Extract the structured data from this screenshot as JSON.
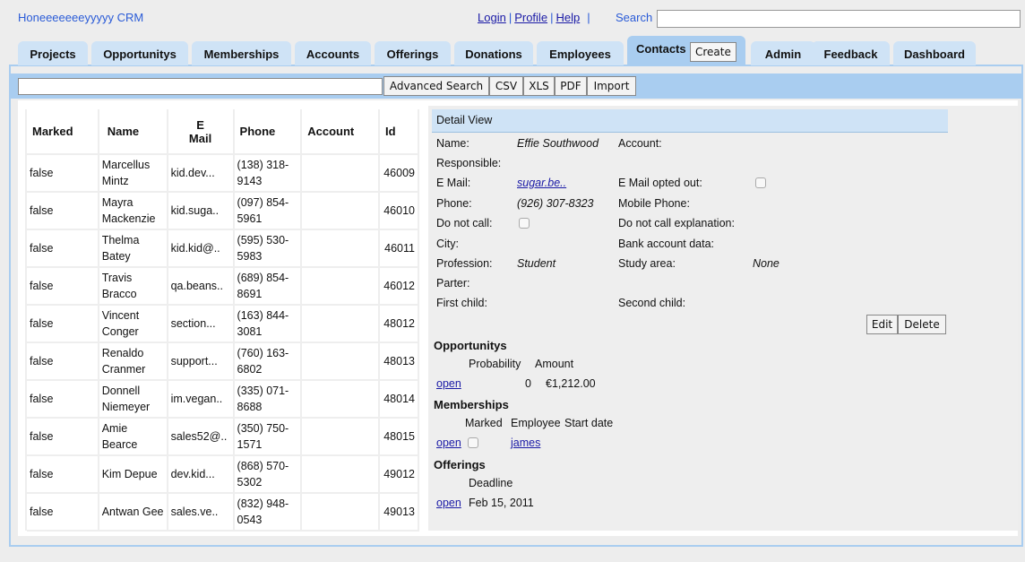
{
  "header": {
    "brand": "Honeeeeeeeyyyyy CRM",
    "links": [
      "Login",
      "Profile",
      "Help"
    ],
    "search_label": "Search",
    "search_value": ""
  },
  "tabs": [
    {
      "label": "Projects"
    },
    {
      "label": "Opportunitys"
    },
    {
      "label": "Memberships"
    },
    {
      "label": "Accounts"
    },
    {
      "label": "Offerings"
    },
    {
      "label": "Donations"
    },
    {
      "label": "Employees"
    },
    {
      "label": "Contacts",
      "active": true
    },
    {
      "label": "Admin"
    },
    {
      "label": "Feedback"
    },
    {
      "label": "Dashboard"
    }
  ],
  "create_label": "Create",
  "toolbar": {
    "search_value": "",
    "buttons": [
      "Advanced Search",
      "CSV",
      "XLS",
      "PDF",
      "Import"
    ]
  },
  "table": {
    "columns": [
      "Marked",
      "Name",
      "E Mail",
      "Phone",
      "Account",
      "Id"
    ],
    "rows": [
      [
        "false",
        "Marcellus Mintz",
        "kid.dev...",
        "(138) 318-9143",
        "",
        "46009"
      ],
      [
        "false",
        "Mayra Mackenzie",
        "kid.suga..",
        "(097) 854-5961",
        "",
        "46010"
      ],
      [
        "false",
        "Thelma Batey",
        "kid.kid@..",
        "(595) 530-5983",
        "",
        "46011"
      ],
      [
        "false",
        "Travis Bracco",
        "qa.beans..",
        "(689) 854-8691",
        "",
        "46012"
      ],
      [
        "false",
        "Vincent Conger",
        "section...",
        "(163) 844-3081",
        "",
        "48012"
      ],
      [
        "false",
        "Renaldo Cranmer",
        "support...",
        "(760) 163-6802",
        "",
        "48013"
      ],
      [
        "false",
        "Donnell Niemeyer",
        "im.vegan..",
        "(335) 071-8688",
        "",
        "48014"
      ],
      [
        "false",
        "Amie Bearce",
        "sales52@..",
        "(350) 750-1571",
        "",
        "48015"
      ],
      [
        "false",
        "Kim Depue",
        "dev.kid...",
        "(868) 570-5302",
        "",
        "49012"
      ],
      [
        "false",
        "Antwan Gee",
        "sales.ve..",
        "(832) 948-0543",
        "",
        "49013"
      ]
    ]
  },
  "detail": {
    "title": "Detail View",
    "name_label": "Name:",
    "name": "Effie Southwood",
    "account_label": "Account:",
    "responsible_label": "Responsible:",
    "email_label": "E Mail:",
    "email": "sugar.be..",
    "optout_label": "E Mail opted out:",
    "optout": false,
    "phone_label": "Phone:",
    "phone": "(926) 307-8323",
    "mobile_label": "Mobile Phone:",
    "dnc_label": "Do not call:",
    "dnc": false,
    "dnc_expl_label": "Do not call explanation:",
    "city_label": "City:",
    "bank_label": "Bank account data:",
    "profession_label": "Profession:",
    "profession": "Student",
    "study_label": "Study area:",
    "study": "None",
    "parter_label": "Parter:",
    "first_child_label": "First child:",
    "second_child_label": "Second child:",
    "edit": "Edit",
    "delete": "Delete",
    "opps": {
      "title": "Opportunitys",
      "col1": "Probability",
      "col2": "Amount",
      "link": "open",
      "probability": "0",
      "amount": "€1,212.00"
    },
    "members": {
      "title": "Memberships",
      "col1": "Marked",
      "col2": "Employee",
      "col3": "Start date",
      "link": "open",
      "marked": false,
      "employee": "james"
    },
    "offerings": {
      "title": "Offerings",
      "col1": "Deadline",
      "link": "open",
      "deadline": "Feb 15, 2011"
    }
  }
}
